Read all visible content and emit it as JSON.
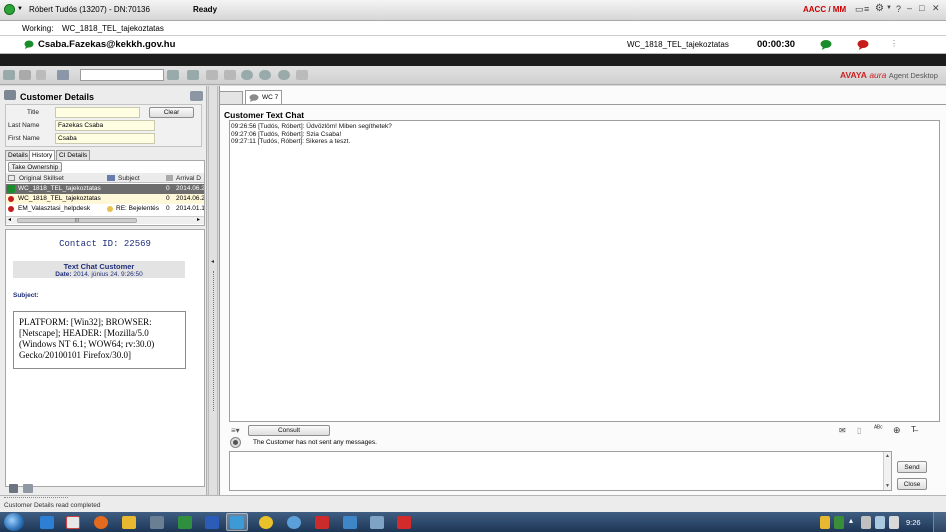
{
  "topbar": {
    "agent": "Róbert Tudós (13207) - DN:70136",
    "state": "Ready",
    "mode": "AACC / MM"
  },
  "working": {
    "label": "Working:",
    "skillset": "WC_1818_TEL_tajekoztatas"
  },
  "callrow": {
    "email": "Csaba.Fazekas@kekkh.gov.hu",
    "skillset": "WC_1818_TEL_tajekoztatas",
    "timer": "00:00:30"
  },
  "toolbar": {
    "brand_avaya": "AVAYA",
    "brand_aura": "aura",
    "brand_product": "Agent Desktop"
  },
  "customer": {
    "heading": "Customer Details",
    "title_label": "Title",
    "title_value": "",
    "clear_label": "Clear",
    "lastname_label": "Last Name",
    "lastname_value": "Fazekas Csaba",
    "firstname_label": "First Name",
    "firstname_value": "Csaba",
    "tabs": [
      "Details",
      "History",
      "CI Details"
    ],
    "take_ownership": "Take Ownership",
    "columns": [
      "Original Skillset",
      "Subject",
      "Arrival D"
    ],
    "rows": [
      {
        "skillset": "WC_1818_TEL_tajekoztatas",
        "subject": "",
        "count": "0",
        "arrival": "2014.06.2"
      },
      {
        "skillset": "WC_1818_TEL_tajekoztatas",
        "subject": "",
        "count": "0",
        "arrival": "2014.06.2"
      },
      {
        "skillset": "EM_Valasztasi_helpdesk",
        "subject": "RE: Bejelentés",
        "count": "0",
        "arrival": "2014.01.1"
      }
    ],
    "scroll_marker": "III",
    "detail": {
      "contact_id": "Contact ID: 22569",
      "box_title": "Text Chat Customer",
      "date_label": "Date:",
      "date_value": "2014. június 24. 9:26:50",
      "subject_label": "Subject:",
      "body": "PLATFORM: [Win32]; BROWSER: [Netscape]; HEADER: [Mozilla/5.0 (Windows NT 6.1; WOW64; rv:30.0) Gecko/20100101 Firefox/30.0]"
    }
  },
  "chat": {
    "tab_label": "WC 7",
    "heading": "Customer Text Chat",
    "lines": [
      "09:26:56 [Tudós, Róbert]: Üdvözlöm! Miben segíthetek?",
      "09:27:06 [Tudós, Róbert]: Szia Csaba!",
      "09:27:11 [Tudós, Róbert]: Sikeres a teszt."
    ],
    "consult_label": "Consult",
    "no_messages": "The Customer has not sent any messages.",
    "send_label": "Send",
    "close_label": "Close"
  },
  "status": {
    "text": "Customer Details read completed"
  },
  "taskbar": {
    "clock": "9:26"
  },
  "colors": {
    "aacc_red": "#cc0000",
    "avaya_red": "#cc1f1f",
    "selected_row": "#6d6d6d",
    "green": "#1a8c2c"
  }
}
